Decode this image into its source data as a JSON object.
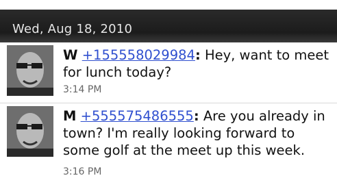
{
  "date_header": "Wed, Aug 18, 2010",
  "messages": [
    {
      "sender_initial": "W",
      "phone": "+155558029984",
      "text": "Hey, want to meet for lunch today?",
      "time": "3:14 PM"
    },
    {
      "sender_initial": "M",
      "phone": "+555575486555",
      "text": "Are you already in town? I'm really looking forward to some golf at the meet up this week.",
      "time": "3:16 PM"
    }
  ]
}
